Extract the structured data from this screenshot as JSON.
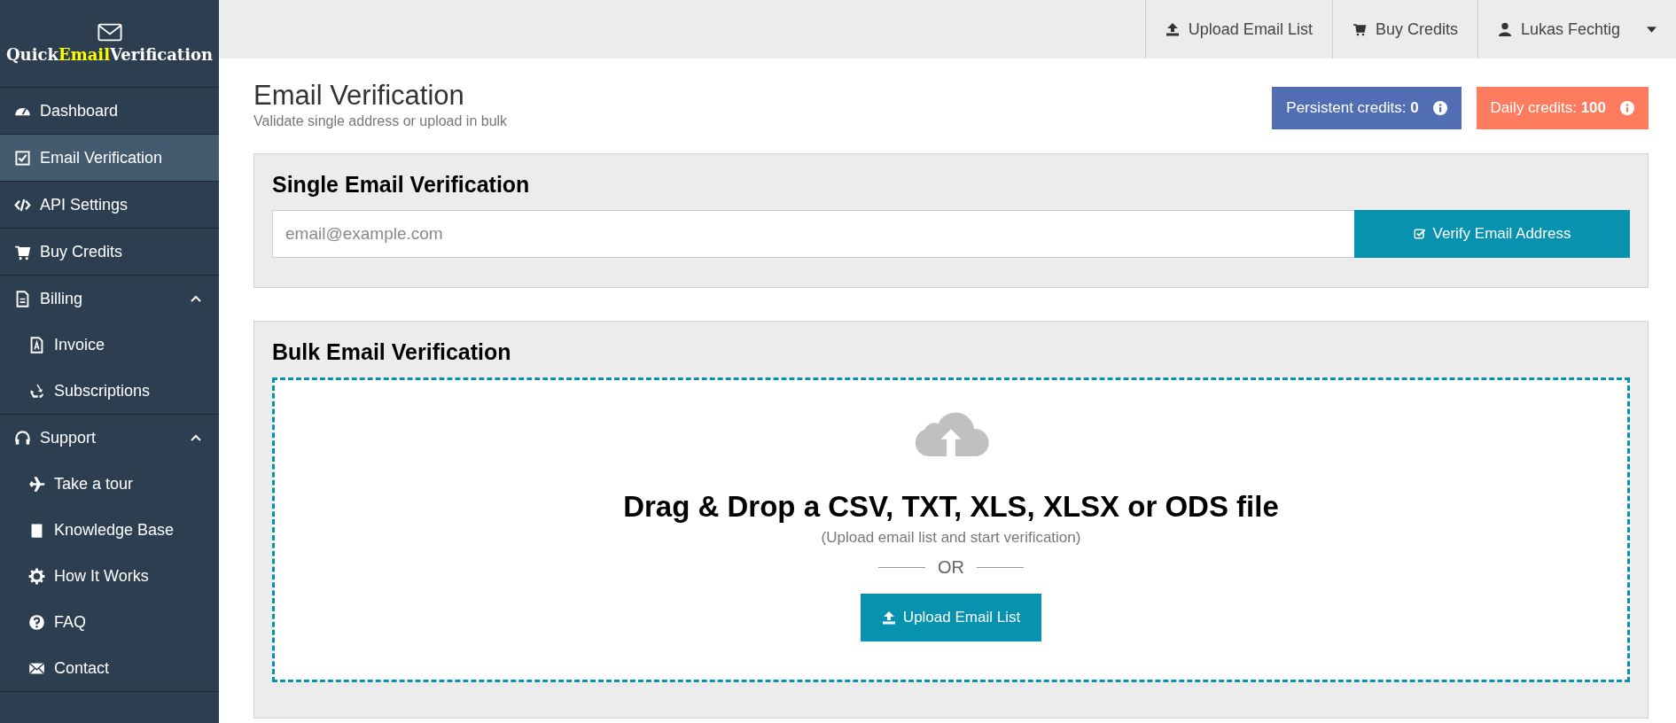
{
  "logo": {
    "text_before": "Quick",
    "highlight": "Email",
    "text_after": "Verification"
  },
  "sidebar": {
    "items": [
      {
        "label": "Dashboard",
        "selected": false
      },
      {
        "label": "Email Verification",
        "selected": true
      },
      {
        "label": "API Settings",
        "selected": false
      },
      {
        "label": "Buy Credits",
        "selected": false
      },
      {
        "label": "Billing",
        "selected": false,
        "expanded": true,
        "children": [
          {
            "label": "Invoice",
            "selected": false
          },
          {
            "label": "Subscriptions",
            "selected": false
          }
        ]
      },
      {
        "label": "Support",
        "selected": false,
        "expanded": true,
        "children": [
          {
            "label": "Take a tour",
            "selected": false
          },
          {
            "label": "Knowledge Base",
            "selected": false
          },
          {
            "label": "How It Works",
            "selected": false
          },
          {
            "label": "FAQ",
            "selected": false
          },
          {
            "label": "Contact",
            "selected": false
          }
        ]
      }
    ]
  },
  "topbar": {
    "items": [
      {
        "kind": "upload",
        "label": "Upload Email List"
      },
      {
        "kind": "cart",
        "label": "Buy Credits"
      },
      {
        "kind": "user",
        "label": "Lukas Fechtig"
      }
    ]
  },
  "page": {
    "title": "Email Verification",
    "subtitle": "Validate single address or upload in bulk"
  },
  "credits": [
    {
      "text": "Persistent credits: **0**",
      "color": "#516eb5"
    },
    {
      "text": "Daily credits: **100**",
      "color": "#fd7c60"
    }
  ],
  "single": {
    "title": "Single Email Verification",
    "placeholder": "email@example.com",
    "button": "Verify Email Address"
  },
  "bulk": {
    "title": "Bulk Email Verification",
    "heading": "Drag & Drop a CSV, TXT, XLS, XLSX or ODS file",
    "hint": "(Upload email list and start verification)",
    "divider": "OR",
    "button": "Upload Email List"
  }
}
